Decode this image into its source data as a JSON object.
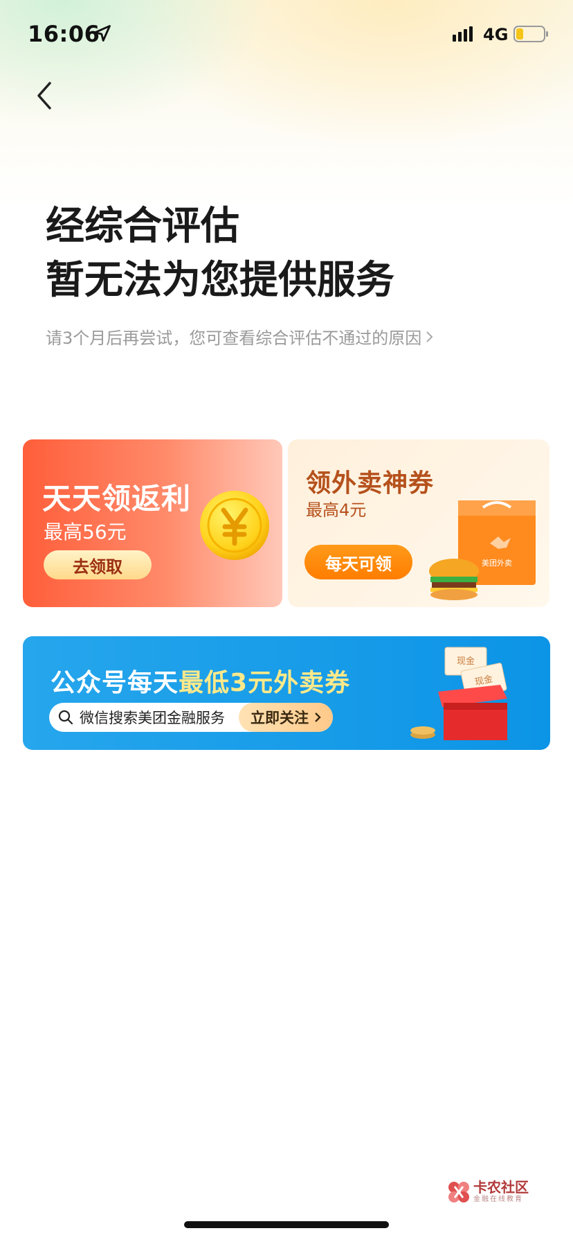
{
  "status_bar": {
    "time": "16:06",
    "network": "4G"
  },
  "headline": {
    "line1": "经综合评估",
    "line2": "暂无法为您提供服务"
  },
  "subline": "请3个月后再尝试，您可查看综合评估不通过的原因",
  "cards": {
    "rebate": {
      "title": "天天领返利",
      "subtitle": "最高56元",
      "button": "去领取"
    },
    "coupon": {
      "title": "领外卖神券",
      "subtitle": "最高4元",
      "button": "每天可领",
      "bag_text": "美团外卖"
    }
  },
  "wechat_banner": {
    "title_part1": "公众号每天",
    "title_part2": "最低3元外卖券",
    "search_text": "微信搜索美团金融服务",
    "follow_button": "立即关注",
    "note_text_1": "现金",
    "note_text_2": "现金"
  },
  "watermark": {
    "name": "卡农社区",
    "tagline": "金融在线教育"
  },
  "colors": {
    "rebate_red": "#ff5e3a",
    "coupon_orange": "#ff7d00",
    "banner_blue": "#0c94e6"
  }
}
